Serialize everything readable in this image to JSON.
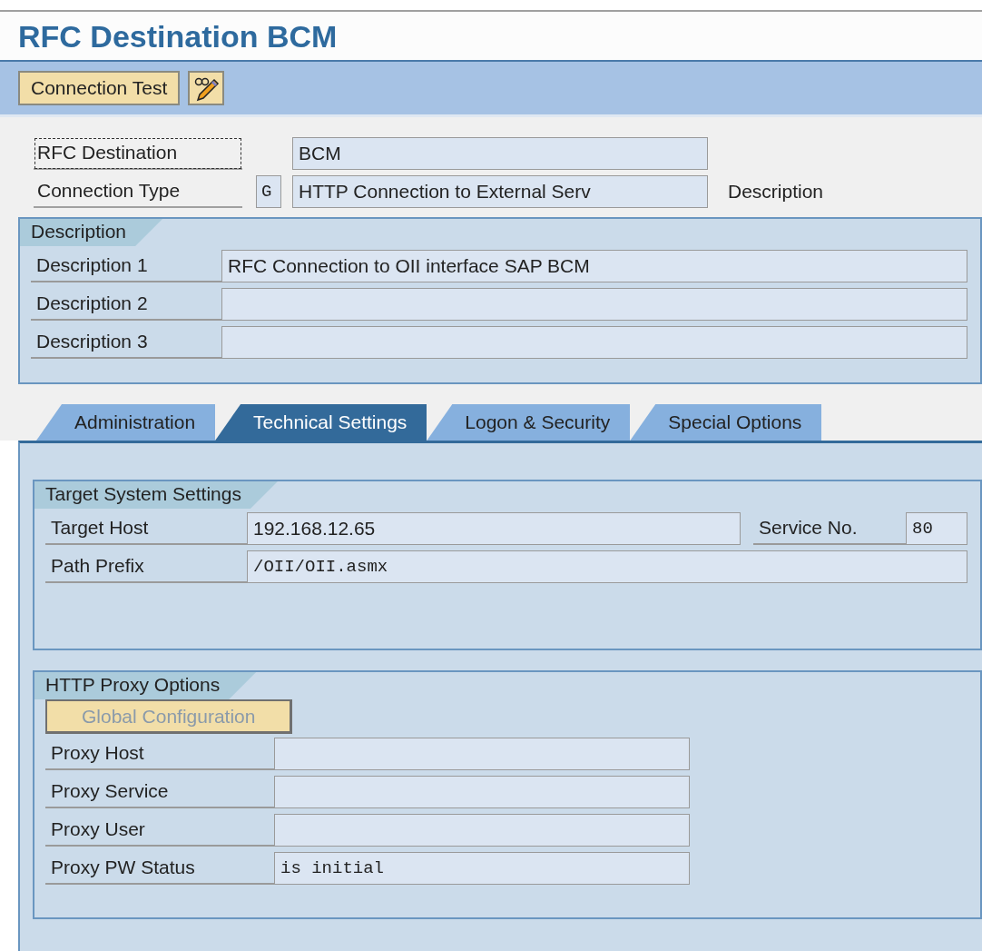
{
  "title": "RFC Destination BCM",
  "toolbar": {
    "buttons": [
      {
        "kind": "text",
        "label": "Connection Test"
      },
      {
        "kind": "icon"
      }
    ]
  },
  "header": {
    "rows": [
      {
        "label": "RFC Destination",
        "focused": true,
        "value": "BCM"
      },
      {
        "label": "Connection Type",
        "focused": false,
        "code": "G",
        "value": "HTTP Connection to External Serv",
        "note": "Description"
      }
    ]
  },
  "description": {
    "title": "Description",
    "rows": [
      {
        "label": "Description 1",
        "value": "RFC Connection to OII interface SAP BCM"
      },
      {
        "label": "Description 2"
      },
      {
        "label": "Description 3"
      }
    ]
  },
  "tabs": [
    {
      "label": "Administration",
      "selected": false
    },
    {
      "label": "Technical Settings",
      "selected": true
    },
    {
      "label": "Logon & Security",
      "selected": false
    },
    {
      "label": "Special Options",
      "selected": false
    }
  ],
  "target_system": {
    "title": "Target System Settings",
    "rows": [
      {
        "label": "Target Host",
        "value": "192.168.12.65",
        "kind": "text",
        "extra": {
          "label": "Service No.",
          "value": "80"
        }
      },
      {
        "label": "Path Prefix",
        "value": "/OII/OII.asmx",
        "kind": "mono"
      }
    ]
  },
  "proxy": {
    "title": "HTTP Proxy Options",
    "button": {
      "label": "Global Configuration",
      "disabled": true
    },
    "rows": [
      {
        "label": "Proxy Host",
        "kind": "text"
      },
      {
        "label": "Proxy Service",
        "kind": "text"
      },
      {
        "label": "Proxy User",
        "kind": "text"
      },
      {
        "label": "Proxy PW Status",
        "value": "is initial",
        "kind": "mono"
      }
    ]
  }
}
